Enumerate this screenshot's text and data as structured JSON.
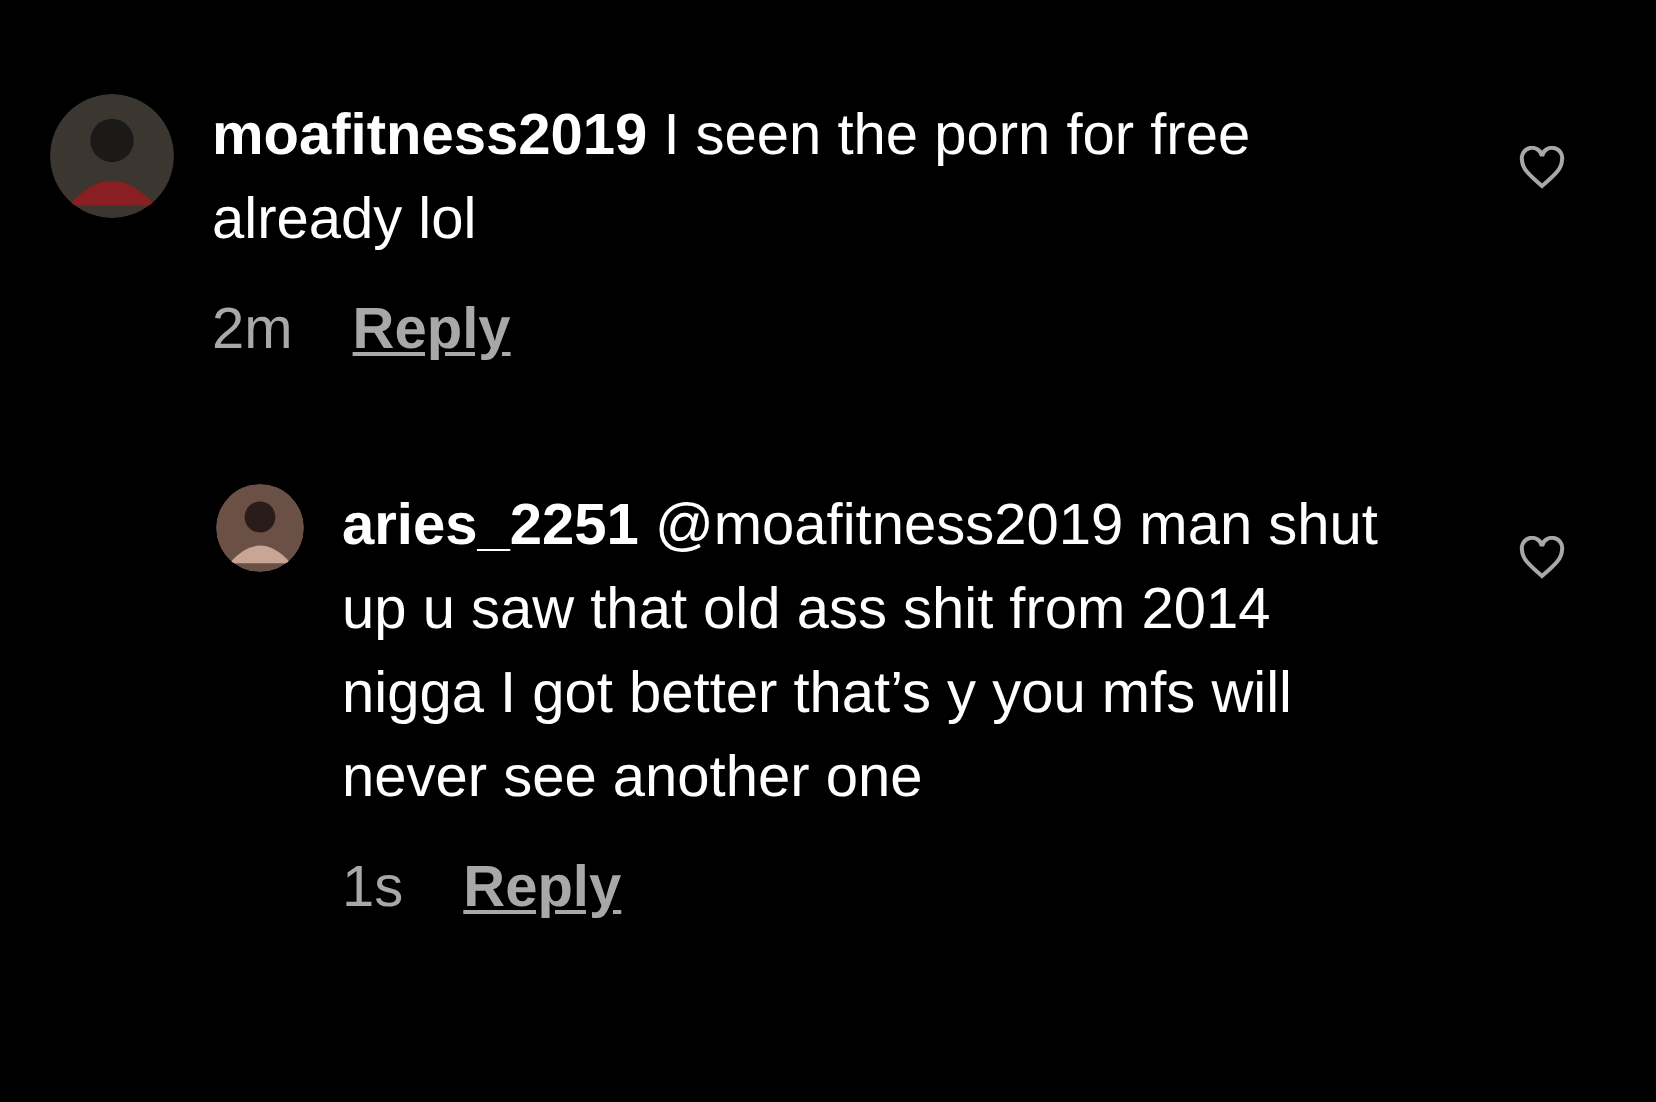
{
  "comments": [
    {
      "username": "moafitness2019",
      "text": "I seen the porn for free already lol",
      "time": "2m",
      "reply_label": "Reply",
      "replies": [
        {
          "username": "aries_2251",
          "text": "@moafitness2019 man shut up u saw that old ass shit from 2014 nigga I got better that’s y you mfs will never see another one",
          "time": "1s",
          "reply_label": "Reply"
        }
      ]
    }
  ]
}
